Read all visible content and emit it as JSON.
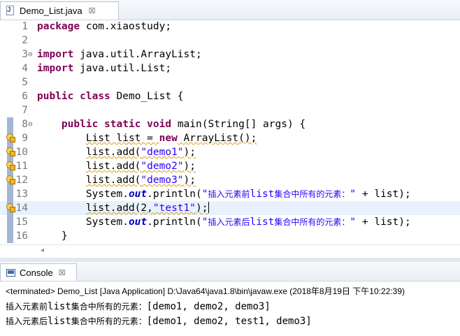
{
  "editor": {
    "tab_title": "Demo_List.java",
    "tab_close": "☒",
    "lines": [
      {
        "num": "1"
      },
      {
        "num": "2"
      },
      {
        "num": "3",
        "fold": "⊖"
      },
      {
        "num": "4"
      },
      {
        "num": "5"
      },
      {
        "num": "6"
      },
      {
        "num": "7"
      },
      {
        "num": "8",
        "fold": "⊖"
      },
      {
        "num": "9"
      },
      {
        "num": "10"
      },
      {
        "num": "11"
      },
      {
        "num": "12"
      },
      {
        "num": "13"
      },
      {
        "num": "14"
      },
      {
        "num": "15"
      },
      {
        "num": "16"
      }
    ],
    "tokens": {
      "l1_kw": "package",
      "l1_rest": " com.xiaostudy;",
      "l3_kw": "import",
      "l3_rest": " java.util.ArrayList;",
      "l4_kw": "import",
      "l4_rest": " java.util.List;",
      "l6_kw1": "public",
      "l6_sp": " ",
      "l6_kw2": "class",
      "l6_rest": " Demo_List {",
      "l8_indent": "    ",
      "l8_kw1": "public",
      "l8_sp1": " ",
      "l8_kw2": "static",
      "l8_sp2": " ",
      "l8_kw3": "void",
      "l8_rest": " main(String[] args) {",
      "l9_indent": "        ",
      "l9_a": "List list = ",
      "l9_kw": "new",
      "l9_b": " ArrayList();",
      "l10_indent": "        ",
      "l10_a": "list.add(",
      "l10_str": "\"demo1\"",
      "l10_b": ");",
      "l11_indent": "        ",
      "l11_a": "list.add(",
      "l11_str": "\"demo2\"",
      "l11_b": ");",
      "l12_indent": "        ",
      "l12_a": "list.add(",
      "l12_str": "\"demo3\"",
      "l12_b": ");",
      "l13_indent": "        ",
      "l13_a": "System.",
      "l13_fld": "out",
      "l13_b": ".println(",
      "l13_q1": "\"",
      "l13_cn1": "插入元素前",
      "l13_str_mid": "list",
      "l13_cn2": "集合中所有的元素：",
      "l13_q2": "\"",
      "l13_c": " + list);",
      "l14_indent": "        ",
      "l14_a": "list.add(2,",
      "l14_str": "\"test1\"",
      "l14_b": ");",
      "l15_indent": "        ",
      "l15_a": "System.",
      "l15_fld": "out",
      "l15_b": ".println(",
      "l15_q1": "\"",
      "l15_cn1": "插入元素后",
      "l15_str_mid": "list",
      "l15_cn2": "集合中所有的元素：",
      "l15_q2": "\"",
      "l15_c": " + list);",
      "l16_indent": "    ",
      "l16_a": "}"
    },
    "scroll_left": "◂"
  },
  "console": {
    "tab_title": "Console",
    "tab_close": "☒",
    "terminated": "<terminated> Demo_List [Java Application] D:\\Java64\\java1.8\\bin\\javaw.exe (2018年8月19日 下午10:22:39)",
    "output": [
      {
        "cn1": "插入元素前",
        "mid": "list",
        "cn2": "集合中所有的元素：",
        "value": "[demo1, demo2, demo3]"
      },
      {
        "cn1": "插入元素后",
        "mid": "list",
        "cn2": "集合中所有的元素：",
        "value": "[demo1, demo2, test1, demo3]"
      }
    ]
  },
  "colors": {
    "keyword": "#7f0055",
    "string": "#2a00ff",
    "field": "#0000c0",
    "line_number": "#787878",
    "current_line": "#e8f2fe"
  }
}
